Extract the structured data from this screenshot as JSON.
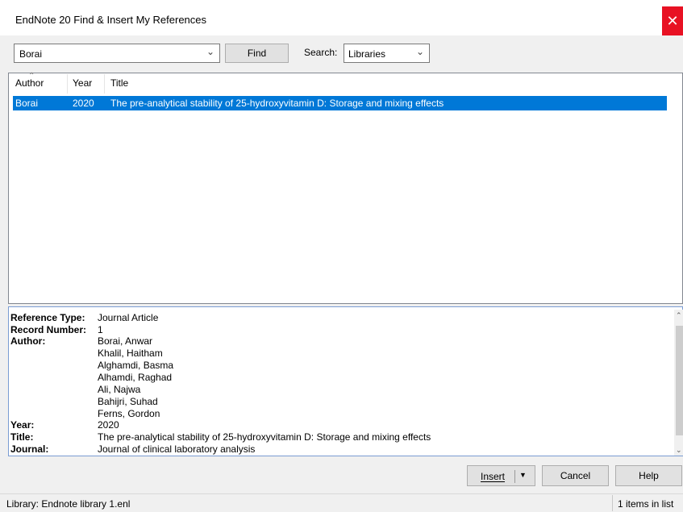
{
  "window": {
    "title": "EndNote 20 Find & Insert My References",
    "close_glyph": "✕"
  },
  "search": {
    "query": "Borai",
    "find_label": "Find",
    "search_label": "Search:",
    "scope_value": "Libraries"
  },
  "list": {
    "columns": {
      "author": "Author",
      "year": "Year",
      "title": "Title"
    },
    "rows": [
      {
        "author": "Borai",
        "year": "2020",
        "title": "The pre-analytical stability of 25-hydroxyvitamin D: Storage and mixing effects"
      }
    ]
  },
  "details": {
    "reference_type_label": "Reference Type:",
    "reference_type": "Journal Article",
    "record_number_label": "Record Number:",
    "record_number": "1",
    "author_label": "Author:",
    "authors": [
      "Borai, Anwar",
      "Khalil, Haitham",
      "Alghamdi, Basma",
      "Alhamdi, Raghad",
      "Ali, Najwa",
      "Bahijri, Suhad",
      "Ferns, Gordon"
    ],
    "year_label": "Year:",
    "year": "2020",
    "title_label": "Title:",
    "title": "The pre-analytical stability of 25-hydroxyvitamin D: Storage and mixing effects",
    "journal_label": "Journal:",
    "journal": "Journal of clinical laboratory analysis"
  },
  "buttons": {
    "insert": "Insert",
    "cancel": "Cancel",
    "help": "Help"
  },
  "status": {
    "library": "Library: Endnote library 1.enl",
    "count": "1 items in list"
  },
  "colors": {
    "selection": "#0078d7",
    "close": "#e81123"
  }
}
